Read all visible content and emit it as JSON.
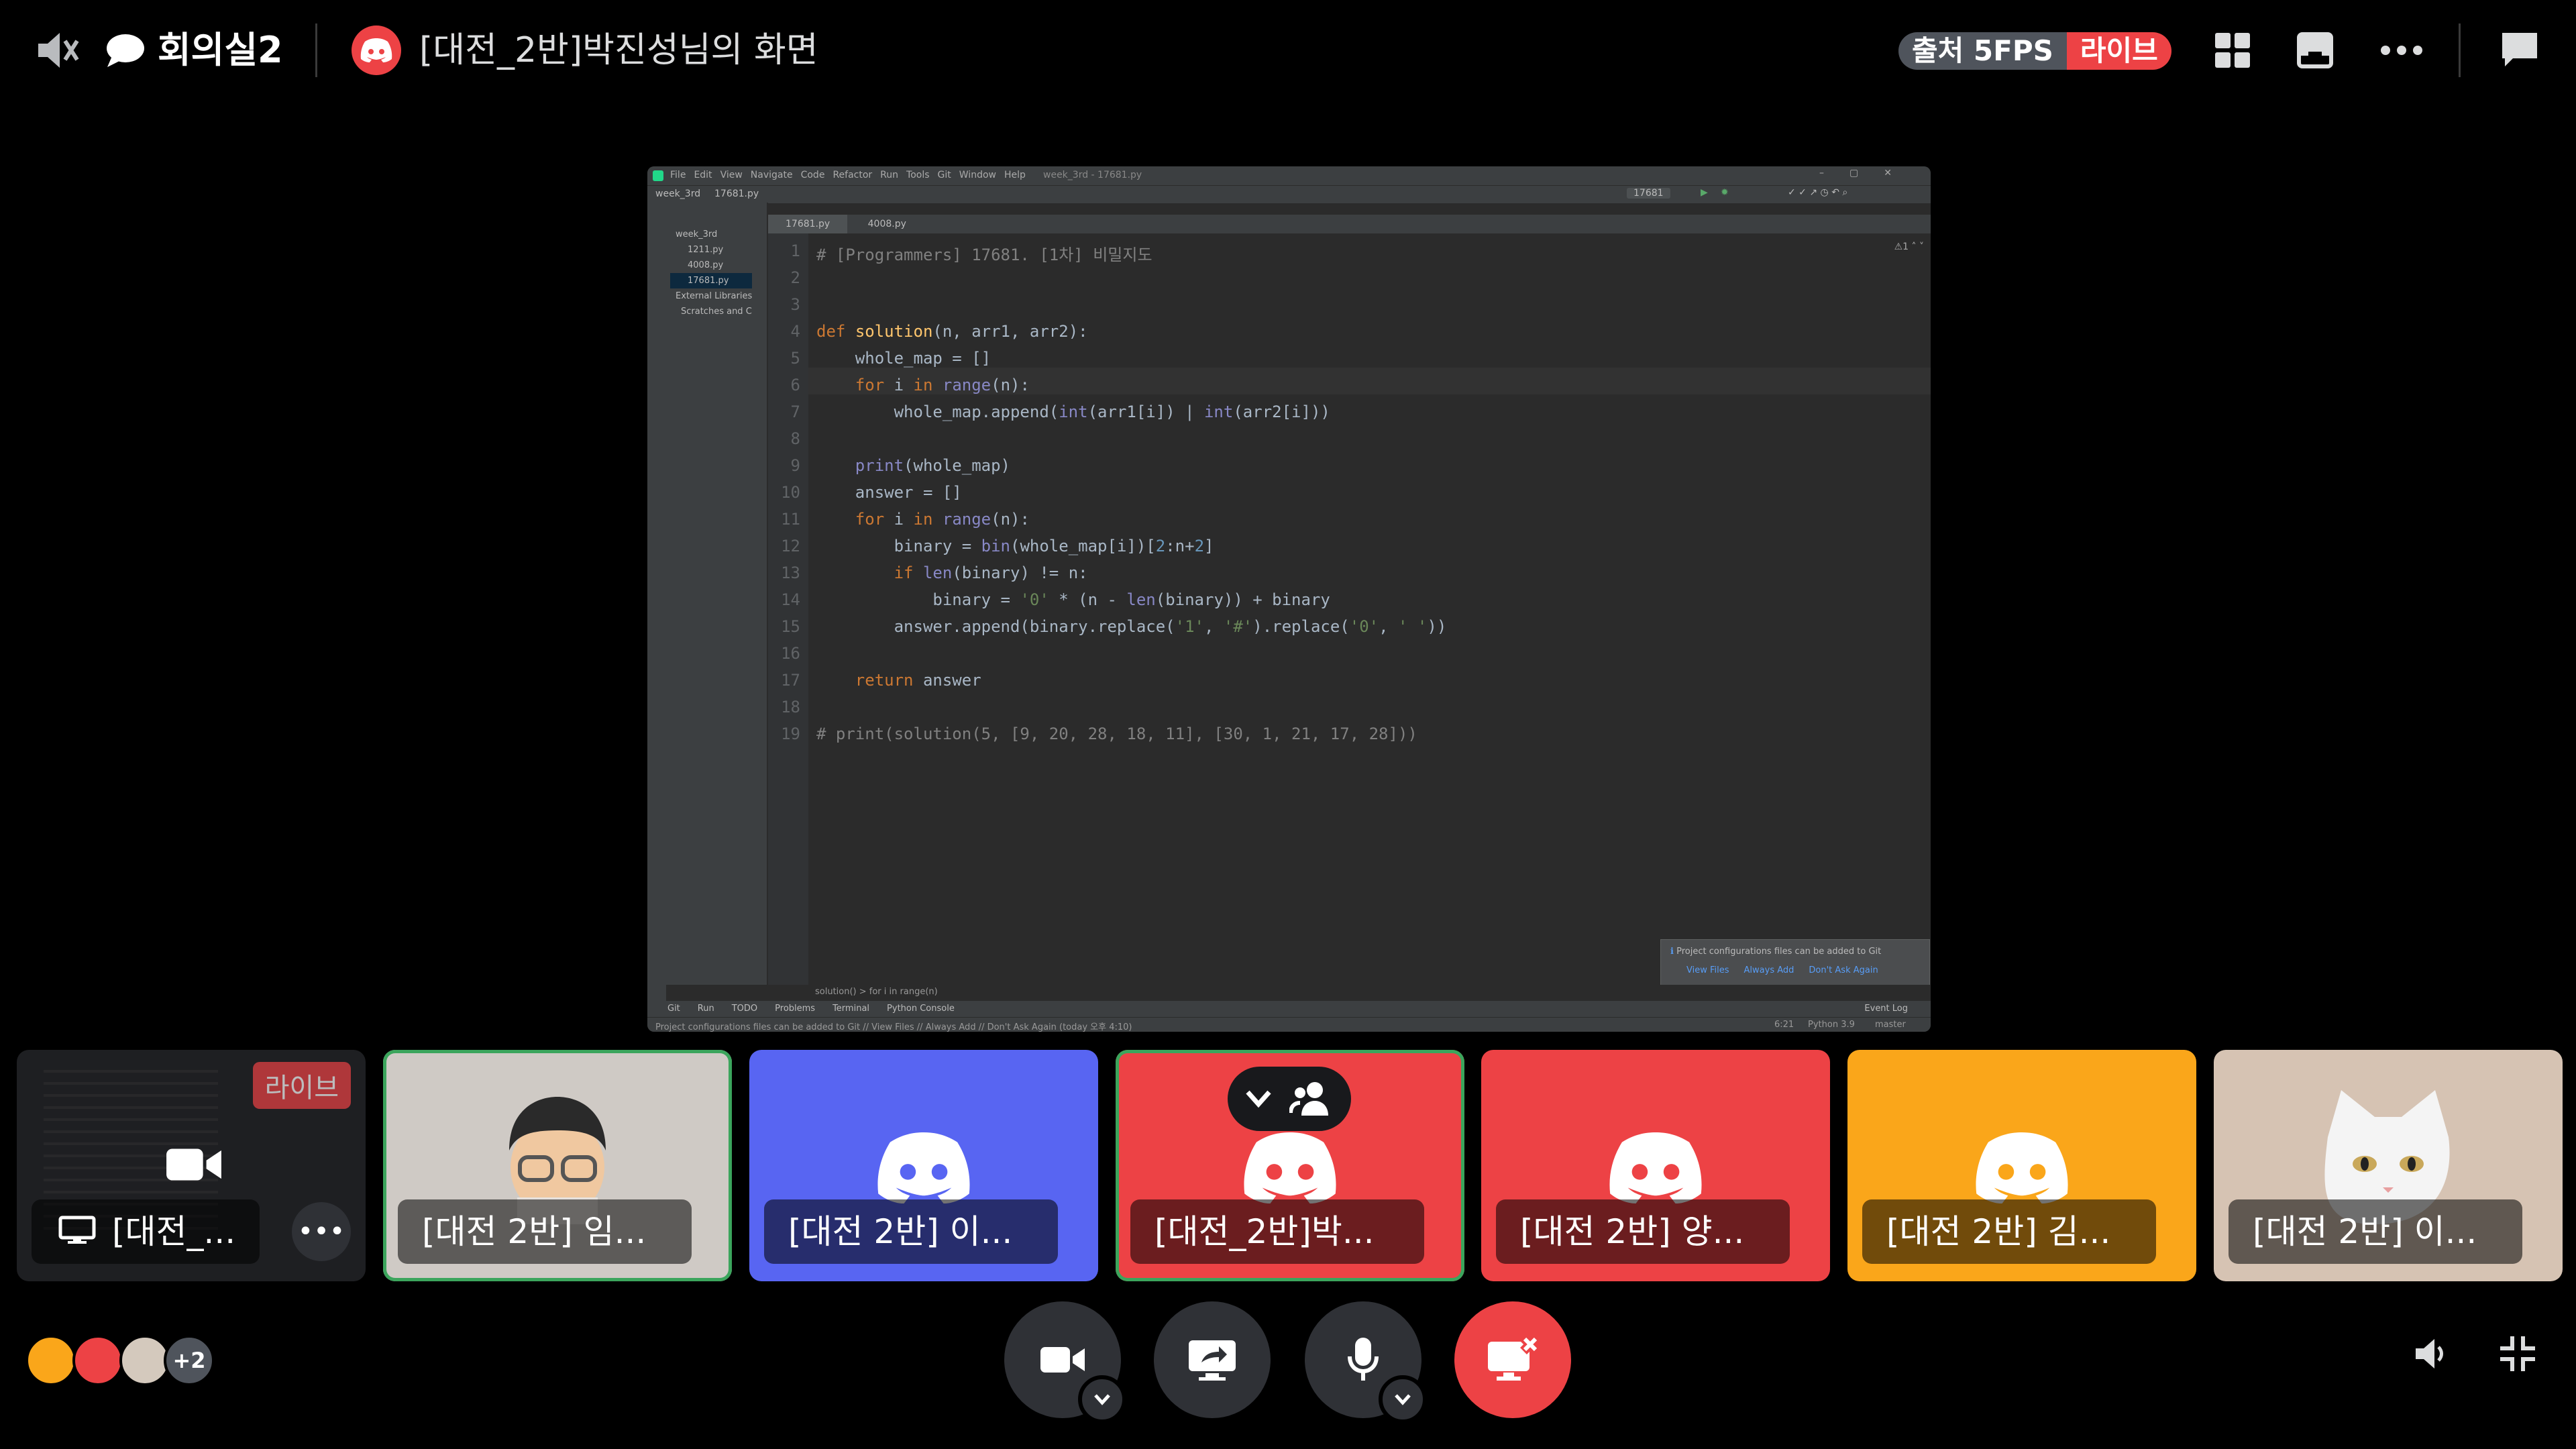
{
  "header": {
    "channel_name": "회의실2",
    "stream_title": "[대전_2반]박진성님의 화면",
    "stream_quality": "출처 5FPS",
    "live_label": "라이브"
  },
  "ide": {
    "menu_items": [
      "File",
      "Edit",
      "View",
      "Navigate",
      "Code",
      "Refactor",
      "Run",
      "Tools",
      "Git",
      "Window",
      "Help"
    ],
    "window_title": "week_3rd - 17681.py",
    "breadcrumb_path": [
      "week_3rd",
      "17681.py"
    ],
    "run_config": "17681",
    "project_tree": [
      "week_3rd",
      "1211.py",
      "4008.py",
      "17681.py",
      "External Libraries",
      "Scratches and C"
    ],
    "tabs": [
      "17681.py",
      "4008.py"
    ],
    "code_lines": [
      "# [Programmers] 17681. [1차] 비밀지도",
      "",
      "",
      "def solution(n, arr1, arr2):",
      "    whole_map = []",
      "    for i in range(n):",
      "        whole_map.append(int(arr1[i]) | int(arr2[i]))",
      "",
      "    print(whole_map)",
      "    answer = []",
      "    for i in range(n):",
      "        binary = bin(whole_map[i])[2:n+2]",
      "        if len(binary) != n:",
      "            binary = '0' * (n - len(binary)) + binary",
      "        answer.append(binary.replace('1', '#').replace('0', ' '))",
      "",
      "    return answer",
      "",
      "# print(solution(5, [9, 20, 28, 18, 11], [30, 1, 21, 17, 28]))"
    ],
    "line_numbers": [
      "1",
      "2",
      "3",
      "4",
      "5",
      "6",
      "7",
      "8",
      "9",
      "10",
      "11",
      "12",
      "13",
      "14",
      "15",
      "16",
      "17",
      "18",
      "19"
    ],
    "code_breadcrumb": "solution()   >   for i in range(n)",
    "bottom_tabs": [
      "Git",
      "Run",
      "TODO",
      "Problems",
      "Terminal",
      "Python Console"
    ],
    "event_log": "Event Log",
    "notification_text": "Project configurations files can be added to Git",
    "notification_links": [
      "View Files",
      "Always Add",
      "Don't Ask Again"
    ],
    "status_left": "Project configurations files can be added to Git // View Files // Always Add // Don't Ask Again (today 오후 4:10)",
    "status_right": [
      "6:21",
      "Python 3.9",
      "master"
    ],
    "inspection": "1"
  },
  "participants": [
    {
      "name": "[대전_...",
      "type": "screen",
      "live": "라이브"
    },
    {
      "name": "[대전 2반] 임...",
      "type": "memoji",
      "speaking": true
    },
    {
      "name": "[대전 2반] 이...",
      "type": "discord",
      "color": "#5865f2"
    },
    {
      "name": "[대전_2반]박...",
      "type": "discord",
      "color": "#ed4245",
      "speaking": true
    },
    {
      "name": "[대전 2반] 양...",
      "type": "discord",
      "color": "#ed4245"
    },
    {
      "name": "[대전 2반] 김...",
      "type": "discord",
      "color": "#faa61a"
    },
    {
      "name": "[대전 2반] 이...",
      "type": "cat"
    }
  ],
  "footer": {
    "extra_count": "+2"
  },
  "colors": {
    "discord_red": "#ed4245",
    "blurple": "#5865f2",
    "yellow": "#faa61a",
    "speaking_green": "#3ba55c"
  }
}
